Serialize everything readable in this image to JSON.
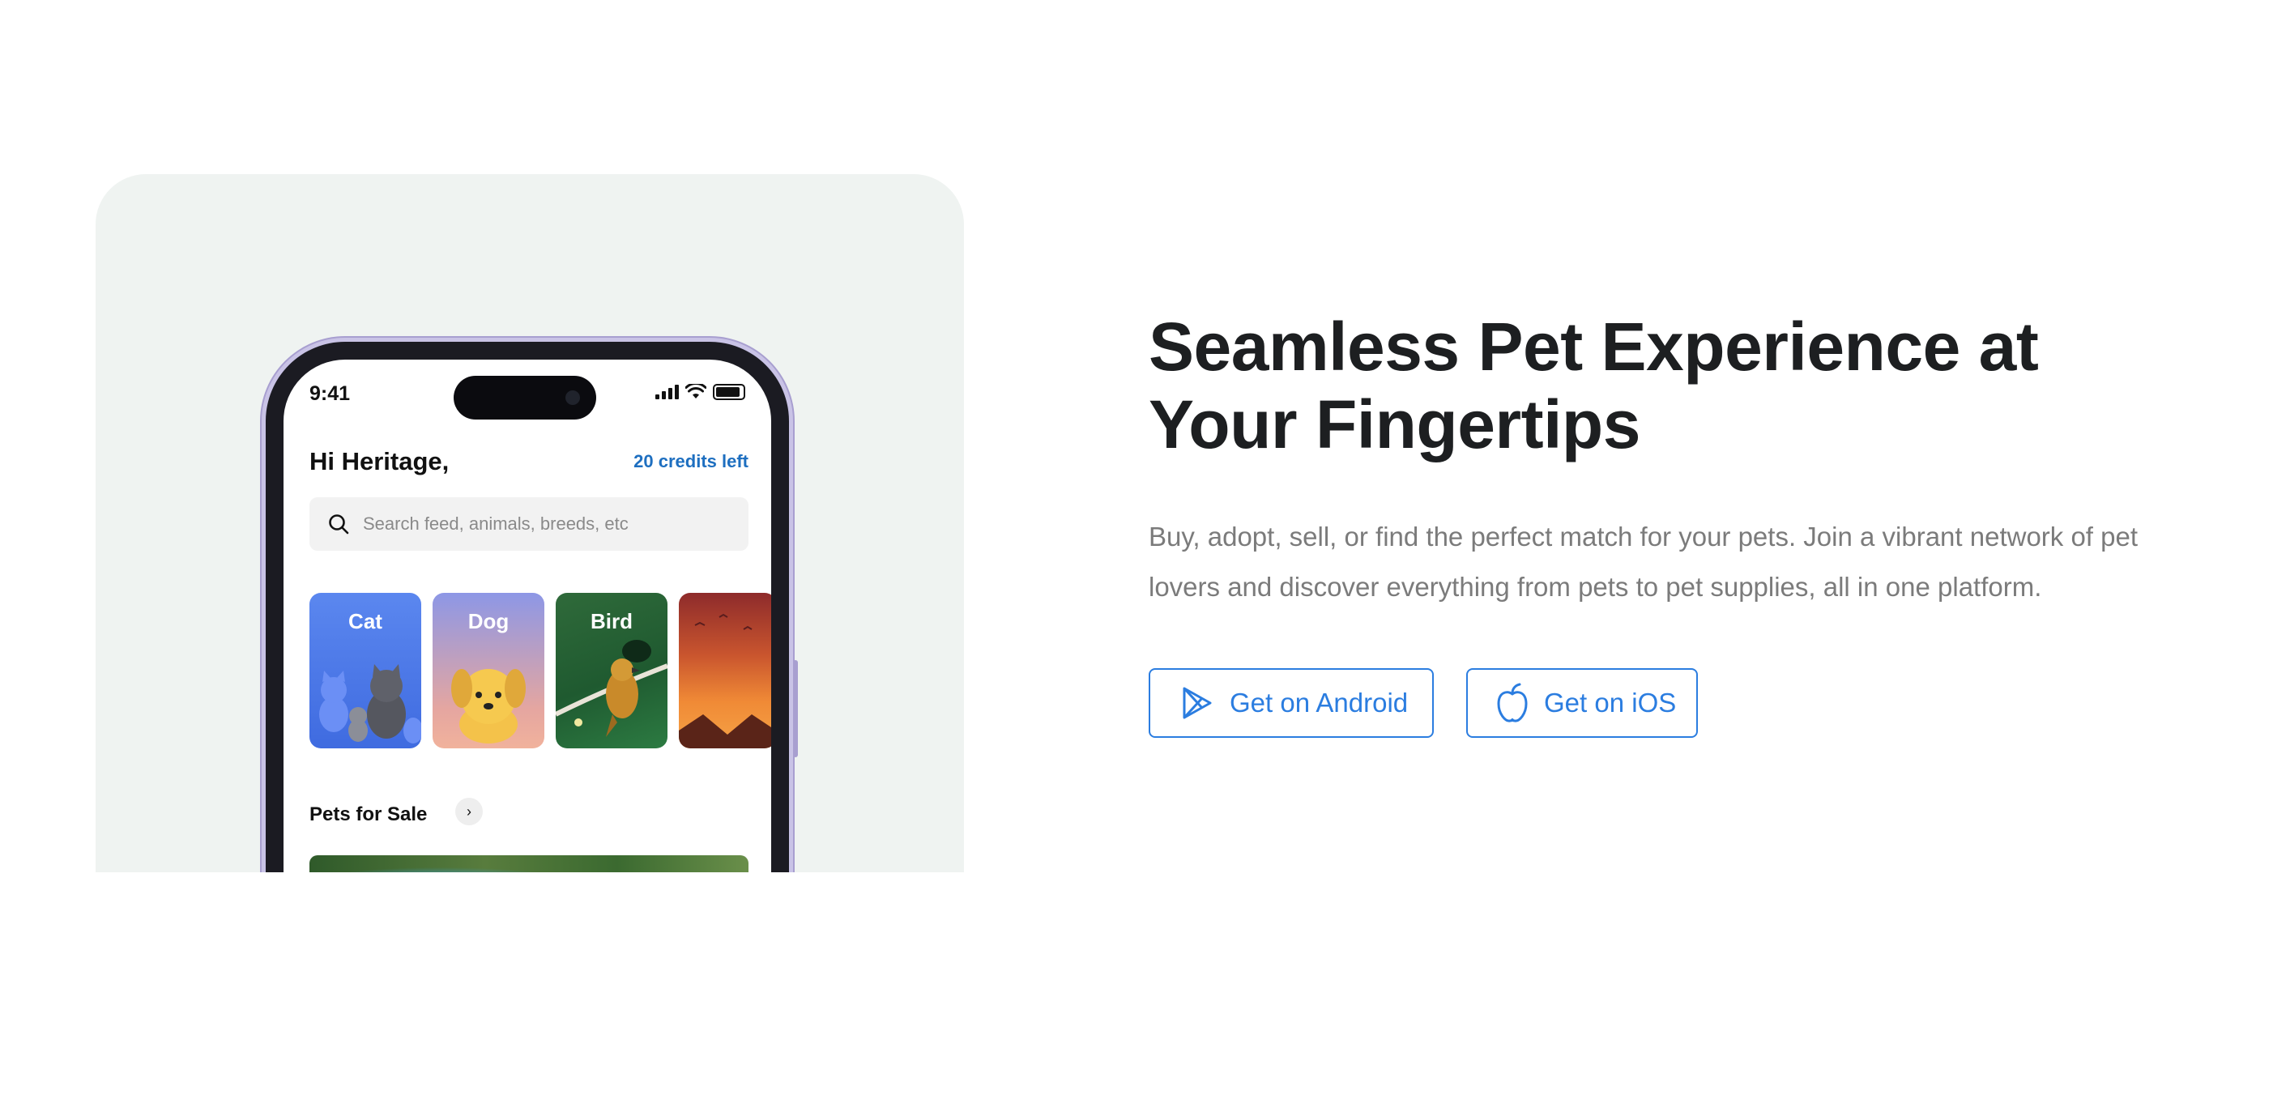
{
  "phone": {
    "status_time": "9:41",
    "greeting": "Hi Heritage,",
    "credits": "20 credits left",
    "search_placeholder": "Search feed, animals, breeds, etc",
    "categories": [
      {
        "label": "Cat"
      },
      {
        "label": "Dog"
      },
      {
        "label": "Bird"
      },
      {
        "label": ""
      }
    ],
    "section_title": "Pets for Sale"
  },
  "hero": {
    "headline": "Seamless Pet Experience at Your Fingertips",
    "description": "Buy, adopt, sell, or find the perfect match for your pets. Join a vibrant network of pet lovers and discover everything from pets to pet supplies, all in one platform."
  },
  "buttons": {
    "android_label": "Get on Android",
    "ios_label": "Get on iOS"
  },
  "icons": {
    "android": "play-store-icon",
    "ios": "apple-icon",
    "search": "search-icon"
  },
  "colors": {
    "accent": "#2b7de0",
    "credits": "#1e6fc0",
    "card_bg": "#eff3f1",
    "headline": "#1d1f21",
    "body_text": "#7b7b7b"
  }
}
